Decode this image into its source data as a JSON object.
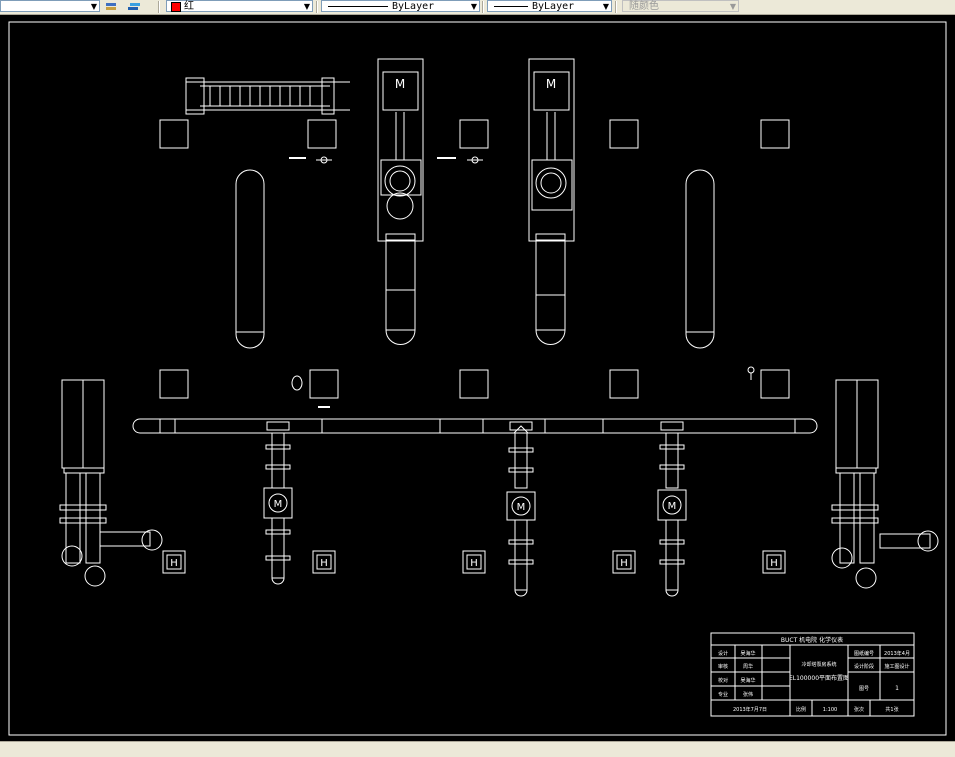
{
  "toolbar": {
    "color_value": "红",
    "linetype_value": "ByLayer",
    "lineweight_value": "ByLayer",
    "plotstyle_value": "随颜色"
  },
  "drawing": {
    "title_block": {
      "header": "BUCT 机电院 化学仪表",
      "cells": {
        "r1c1": "设计",
        "r1c2": "吴海华",
        "r1c4": "图纸编号",
        "r1c5": "2013年4月",
        "r2c1": "审核",
        "r2c2": "周华",
        "r2c4": "设计阶段",
        "r2c5": "施工图设计",
        "r3c1": "校对",
        "r3c2": "吴海华",
        "r3c4": "图号",
        "r3c5": "1",
        "r4c1": "专业",
        "r4c2": "张伟",
        "r5c1": "2013年7月7日",
        "r5c2": "比例",
        "r5c3": "1:100",
        "r5c4": "张次",
        "r5c5": "共1张"
      },
      "project": "冷却塔泵房系统",
      "drawing_name": "EL100000平面布置图"
    },
    "symbols": {
      "motor": "M",
      "support": "H"
    }
  }
}
